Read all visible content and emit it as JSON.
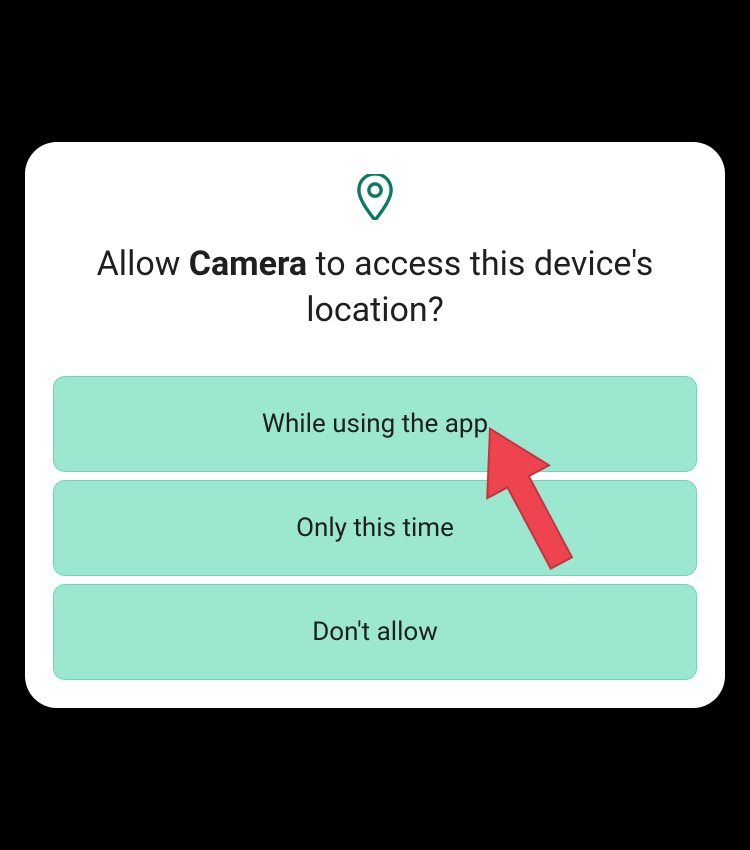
{
  "dialog": {
    "icon": "location-pin",
    "icon_color": "#0b7a63",
    "title_prefix": "Allow ",
    "title_app_name": "Camera",
    "title_suffix": " to access this device's location?",
    "buttons": {
      "while_using": "While using the app",
      "only_this_time": "Only this time",
      "dont_allow": "Don't allow"
    },
    "button_color": "#9be7d0"
  },
  "annotation": {
    "type": "arrow",
    "color": "#ee4450",
    "points_to": "while-using-button"
  }
}
